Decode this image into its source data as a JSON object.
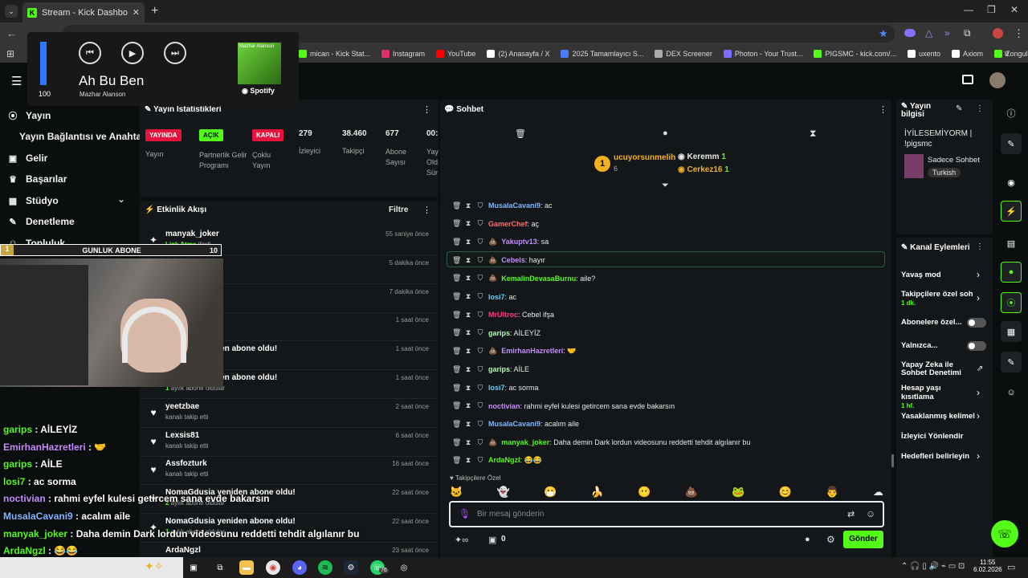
{
  "browser": {
    "tab_title": "Stream - Kick Dashboard",
    "bookmarks": [
      "mican - Kick Stat...",
      "Instagram",
      "YouTube",
      "(2) Anasayfa / X",
      "2025 Tamamlayıcı S...",
      "DEX Screener",
      "Photon - Your Trust...",
      "PIGSMC - kick.com/...",
      "uxento",
      "Axiom",
      "Zonguldak İngilizce..."
    ],
    "bookmark_colors": [
      "#53fc18",
      "#e1306c",
      "#ff0000",
      "#ffffff",
      "#4a7cff",
      "#aaaaaa",
      "#7c6cff",
      "#53fc18",
      "#ffffff",
      "#ffffff",
      "#53fc18"
    ]
  },
  "spotify": {
    "volume": "100",
    "volume_pct": 100,
    "track": "Ah Bu Ben",
    "artist": "Mazhar Alanson",
    "brand": "Spotify",
    "album_text": "Mazhar Alanson"
  },
  "sidebar": {
    "items": [
      "Yayın",
      "Yayın Bağlantısı ve Anahtarı",
      "Gelir",
      "Başarılar",
      "Stüdyo",
      "Denetleme",
      "Topluluk"
    ]
  },
  "goal": {
    "left": "1",
    "label": "GUNLUK ABONE",
    "right": "10"
  },
  "stats": {
    "title": "Yayın İstatistikleri",
    "badges": [
      {
        "text": "YAYINDA",
        "label": "Yayın"
      },
      {
        "text": "AÇIK",
        "label": "Partnerlik Gelir Programı"
      },
      {
        "text": "KAPALI",
        "label": "Çoklu Yayın"
      }
    ],
    "numbers": [
      {
        "value": "279",
        "label": "İzleyici"
      },
      {
        "value": "38.460",
        "label": "Takipçi"
      },
      {
        "value": "677",
        "label": "Abone Sayısı"
      },
      {
        "value": "00:",
        "label": "Yay Old Sür"
      }
    ]
  },
  "activity": {
    "title": "Etkinlik Akışı",
    "filter": "Filtre",
    "rows": [
      {
        "icon": "star",
        "name": "manyak_joker",
        "sub": "Link Atma",
        "sub2": " ilindi",
        "time": "55 saniye önce"
      },
      {
        "icon": "star",
        "name": "",
        "sub": "",
        "sub2": "",
        "time": "5 dakika önce"
      },
      {
        "icon": "star",
        "name": "",
        "sub": "",
        "sub2": "",
        "time": "7 dakika önce"
      },
      {
        "icon": "star",
        "name": "",
        "sub": "",
        "sub2": "",
        "time": "1 saat önce"
      },
      {
        "icon": "star",
        "name": "yeniden abone oldu!",
        "sub": "",
        "sub2": "",
        "time": "1 saat önce"
      },
      {
        "icon": "star",
        "name": "yeniden abone oldu!",
        "sub": "1",
        "sub2": " aylık abone oldular",
        "time": "1 saat önce"
      },
      {
        "icon": "heart",
        "name": "yeetzbae",
        "sub": "",
        "sub2": "kanalı takip etti",
        "time": "2 saat önce"
      },
      {
        "icon": "heart",
        "name": "Lexsis81",
        "sub": "",
        "sub2": "kanalı takip etti",
        "time": "6 saat önce"
      },
      {
        "icon": "heart",
        "name": "Assfozturk",
        "sub": "",
        "sub2": "kanalı takip etti",
        "time": "16 saat önce"
      },
      {
        "icon": "star",
        "name": "NomaGdusia yeniden abone oldu!",
        "sub": "2",
        "sub2": " aylık abone oldular",
        "time": "22 saat önce"
      },
      {
        "icon": "star",
        "name": "NomaGdusia yeniden abone oldu!",
        "sub": "1",
        "sub2": " aylık abone oldular",
        "time": "22 saat önce"
      },
      {
        "icon": "star",
        "name": "ArdaNgzl",
        "sub": "",
        "sub2": "",
        "time": "23 saat önce"
      }
    ]
  },
  "chat": {
    "title": "Sohbet",
    "top_users": [
      {
        "name": "ucuyorsunmelih",
        "count": "6"
      },
      {
        "name": "Keremm",
        "count": "1"
      },
      {
        "name": "Cerkez16",
        "count": "1"
      }
    ],
    "top_rank": "1",
    "messages": [
      {
        "user": "MusalaCavani9",
        "color": "#7fb6ff",
        "badge": "",
        "text": ": ac"
      },
      {
        "user": "GamerChef",
        "color": "#ff6b6b",
        "badge": "",
        "text": ": aç"
      },
      {
        "user": "Yakuptv13",
        "color": "#c58cff",
        "badge": "💩",
        "text": ": sa"
      },
      {
        "user": "Cebels",
        "color": "#c58cff",
        "badge": "💩",
        "text": ": hayır"
      },
      {
        "user": "KemalinDevasaBurnu",
        "color": "#53fc18",
        "badge": "💩",
        "text": ": aile?"
      },
      {
        "user": "losi7",
        "color": "#5fd0ff",
        "badge": "",
        "text": ": ac"
      },
      {
        "user": "MrUltroc",
        "color": "#ff3d7f",
        "badge": "",
        "text": ": Cebel ifşa"
      },
      {
        "user": "garips",
        "color": "#b0ffb0",
        "badge": "",
        "text": ": AİLEYİZ"
      },
      {
        "user": "EmirhanHazretleri",
        "color": "#c58cff",
        "badge": "💩",
        "text": ": 🤝"
      },
      {
        "user": "garips",
        "color": "#b0ffb0",
        "badge": "",
        "text": ": AİLE"
      },
      {
        "user": "losi7",
        "color": "#5fd0ff",
        "badge": "",
        "text": ": ac sorma"
      },
      {
        "user": "noctivian",
        "color": "#c58cff",
        "badge": "",
        "text": ": rahmi eyfel kulesi getircem sana evde bakarsın"
      },
      {
        "user": "MusalaCavani9",
        "color": "#7fb6ff",
        "badge": "",
        "text": ": acalım aile"
      },
      {
        "user": "manyak_joker",
        "color": "#53fc18",
        "badge": "💩",
        "text": ": Daha demin Dark lordun videosunu reddetti tehdit algılanır bu"
      },
      {
        "user": "ArdaNgzl",
        "color": "#53fc18",
        "badge": "",
        "text": ": 😂😂"
      }
    ],
    "followers_only": "Takipçilere Özel",
    "input_placeholder": "Bir mesaj gönderin",
    "send_label": "Gönder",
    "counter": "0"
  },
  "overlay_chat": [
    {
      "user": "garips",
      "color": "#53fc18",
      "text": " : AİLEYİZ"
    },
    {
      "user": "EmirhanHazretleri",
      "color": "#c58cff",
      "text": " : 🤝"
    },
    {
      "user": "garips",
      "color": "#53fc18",
      "text": " : AİLE"
    },
    {
      "user": "losi7",
      "color": "#53fc18",
      "text": " : ac sorma"
    },
    {
      "user": "noctivian",
      "color": "#c58cff",
      "text": " : rahmi eyfel kulesi getircem sana evde bakarsın"
    },
    {
      "user": "MusalaCavani9",
      "color": "#7fb6ff",
      "text": " : acalım aile"
    },
    {
      "user": "manyak_joker",
      "color": "#53fc18",
      "text": " : Daha demin Dark lordun videosunu reddetti tehdit algılanır bu"
    },
    {
      "user": "ArdaNgzl",
      "color": "#53fc18",
      "text": " : 😂😂"
    }
  ],
  "stream_info": {
    "title": "Yayın bilgisi",
    "stream_title": "İYİLESEMİYORM | !pigsmc",
    "category": "Sadece Sohbet",
    "tag": "Turkish"
  },
  "channel_actions": {
    "title": "Kanal Eylemleri",
    "items": [
      {
        "label": "Yavaş mod",
        "sub": "",
        "control": "chevron"
      },
      {
        "label": "Takipçilere özel soh",
        "sub": "1 dk.",
        "control": "chevron"
      },
      {
        "label": "Abonelere özel...",
        "sub": "",
        "control": "toggle"
      },
      {
        "label": "Yalnızca...",
        "sub": "",
        "control": "toggle"
      },
      {
        "label": "Yapay Zeka ile Sohbet Denetimi",
        "sub": "",
        "control": "external"
      },
      {
        "label": "Hesap yaşı kısıtlama",
        "sub": "1 hf.",
        "control": "chevron"
      },
      {
        "label": "Yasaklanmış kelimel",
        "sub": "",
        "control": "chevron"
      },
      {
        "label": "İzleyici Yönlendir",
        "sub": "",
        "control": "none"
      },
      {
        "label": "Hedefleri belirleyin",
        "sub": "",
        "control": "chevron"
      }
    ]
  },
  "taskbar": {
    "time": "11:55",
    "date": "6.02.2026",
    "whatsapp_count": "76"
  }
}
